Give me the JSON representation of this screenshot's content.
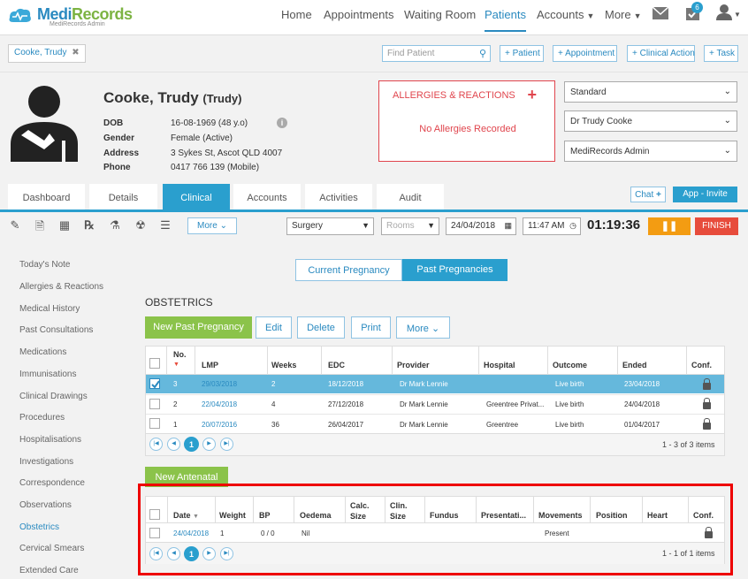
{
  "brand": {
    "name_blue": "Medi",
    "name_green": "Records",
    "tagline": "MediRecords Admin"
  },
  "nav": {
    "items": [
      "Home",
      "Appointments",
      "Waiting Room",
      "Patients",
      "Accounts",
      "More"
    ],
    "active": "Patients",
    "badge_count": "6"
  },
  "patient_tab": {
    "label": "Cooke, Trudy",
    "close": "✖"
  },
  "search": {
    "placeholder": "Find Patient"
  },
  "quick_buttons": [
    "+ Patient",
    "+ Appointment",
    "+ Clinical Action",
    "+ Task"
  ],
  "patient": {
    "name": "Cooke, Trudy",
    "preferred": "(Trudy)",
    "fields": [
      {
        "label": "DOB",
        "value": "16-08-1969 (48 y.o)"
      },
      {
        "label": "Gender",
        "value": "Female (Active)"
      },
      {
        "label": "Address",
        "value": "3 Sykes St, Ascot QLD 4007"
      },
      {
        "label": "Phone",
        "value": "0417 766 139 (Mobile)"
      }
    ]
  },
  "allergies": {
    "title": "ALLERGIES & REACTIONS",
    "message": "No Allergies Recorded"
  },
  "selectors": [
    "Standard",
    "Dr Trudy Cooke",
    "MediRecords Admin"
  ],
  "tabs": [
    "Dashboard",
    "Details",
    "Clinical",
    "Accounts",
    "Activities",
    "Audit"
  ],
  "active_tab": "Clinical",
  "chat_label": "Chat",
  "invite_label": "App - Invite",
  "toolbar": {
    "more_label": "More",
    "location": "Surgery",
    "rooms_placeholder": "Rooms",
    "date": "24/04/2018",
    "time": "11:47 AM",
    "timer": "01:19:36",
    "pause": "❚❚",
    "finish": "FINISH"
  },
  "left_nav": [
    "Today's Note",
    "Allergies & Reactions",
    "Medical History",
    "Past Consultations",
    "Medications",
    "Immunisations",
    "Clinical Drawings",
    "Procedures",
    "Hospitalisations",
    "Investigations",
    "Correspondence",
    "Observations",
    "Obstetrics",
    "Cervical Smears",
    "Extended Care"
  ],
  "left_nav_active": "Obstetrics",
  "segments": {
    "current": "Current Pregnancy",
    "past": "Past Pregnancies"
  },
  "section_title": "OBSTETRICS",
  "pregnancy_actions": {
    "new": "New Past Pregnancy",
    "edit": "Edit",
    "delete": "Delete",
    "print": "Print",
    "more": "More"
  },
  "pregnancy_grid": {
    "columns": [
      "No.",
      "LMP",
      "Weeks",
      "EDC",
      "Provider",
      "Hospital",
      "Outcome",
      "Ended",
      "Conf."
    ],
    "rows": [
      {
        "no": "3",
        "lmp": "29/03/2018",
        "weeks": "2",
        "edc": "18/12/2018",
        "provider": "Dr Mark Lennie",
        "hospital": "",
        "outcome": "Live birth",
        "ended": "23/04/2018",
        "selected": true
      },
      {
        "no": "2",
        "lmp": "22/04/2018",
        "weeks": "4",
        "edc": "27/12/2018",
        "provider": "Dr Mark Lennie",
        "hospital": "Greentree Privat...",
        "outcome": "Live birth",
        "ended": "24/04/2018",
        "selected": false
      },
      {
        "no": "1",
        "lmp": "20/07/2016",
        "weeks": "36",
        "edc": "26/04/2017",
        "provider": "Dr Mark Lennie",
        "hospital": "Greentree",
        "outcome": "Live birth",
        "ended": "01/04/2017",
        "selected": false
      }
    ],
    "page": "1",
    "summary": "1 - 3 of 3 items"
  },
  "antenatal_button": "New Antenatal",
  "antenatal_grid": {
    "columns": [
      "Date",
      "Weight",
      "BP",
      "Oedema",
      "Calc.\nSize",
      "Clin.\nSize",
      "Fundus",
      "Presentati...",
      "Movements",
      "Position",
      "Heart",
      "Conf."
    ],
    "rows": [
      {
        "date": "24/04/2018",
        "weight": "1",
        "bp": "0 / 0",
        "oedema": "Nil",
        "movements": "Present"
      }
    ],
    "page": "1",
    "summary": "1 - 1 of 1 items"
  },
  "colors": {
    "accent": "#2a9fce",
    "brand_green": "#8bc34a",
    "alert_red": "#e0454d",
    "highlight": "#e00000"
  }
}
